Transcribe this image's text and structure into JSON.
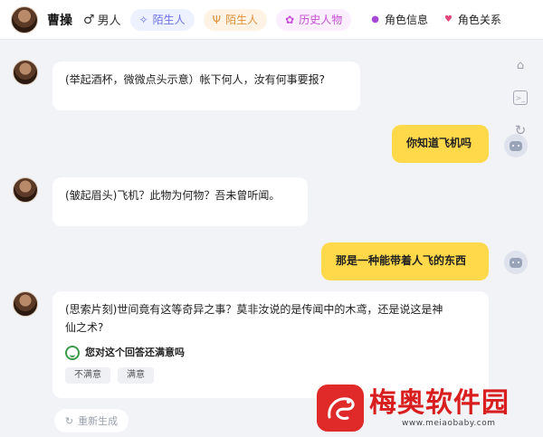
{
  "header": {
    "character_name": "曹操",
    "gender_icon": "male-symbol-icon",
    "gender_label": "男人",
    "tags": [
      {
        "icon": "sparkle-icon",
        "label": "陌生人"
      },
      {
        "icon": "sprout-icon",
        "label": "陌生人"
      },
      {
        "icon": "gear-flower-icon",
        "label": "历史人物"
      }
    ],
    "links": [
      {
        "icon": "dot-icon",
        "label": "角色信息"
      },
      {
        "icon": "heart-icon",
        "label": "角色关系"
      }
    ]
  },
  "messages": [
    {
      "role": "character",
      "text": "(举起酒杯，微微点头示意）帐下何人，汝有何事要报?"
    },
    {
      "role": "user",
      "text": "你知道飞机吗"
    },
    {
      "role": "character",
      "text": "(皱起眉头)飞机？此物为何物？吾未曾听闻。"
    },
    {
      "role": "user",
      "text": "那是一种能带着人飞的东西"
    },
    {
      "role": "character",
      "text_line1": "(思索片刻)世间竟有这等奇异之事？莫非汝说的是传闻中的木鸢，还是说这是神",
      "text_line2": "仙之术?"
    }
  ],
  "feedback": {
    "question": "您对这个回答还满意吗",
    "buttons": [
      "不满意",
      "满意"
    ]
  },
  "side_tools": [
    "broom-icon",
    "terminal-icon",
    "refresh-icon"
  ],
  "regenerate_label": "重新生成",
  "watermark": {
    "name": "梅奥软件园",
    "url": "www.meiaobaby.com"
  },
  "colors": {
    "user_bubble": "#ffd94a",
    "character_bubble": "#ffffff",
    "background": "#f2f3f7",
    "logo_red": "#d81e1e"
  }
}
